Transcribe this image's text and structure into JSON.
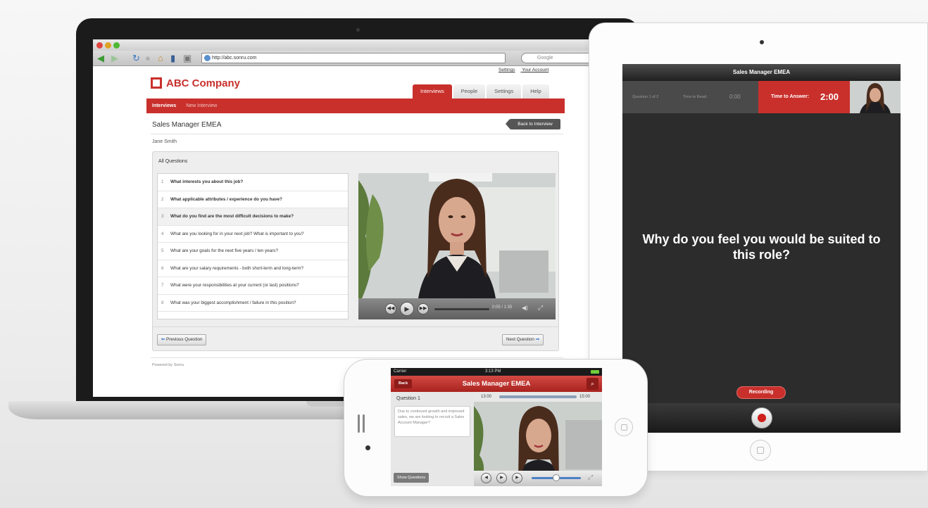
{
  "browser": {
    "url": "http://abc.sonru.com",
    "search_placeholder": "Google"
  },
  "app": {
    "toplinks": [
      "Settings",
      "Your Account"
    ],
    "logo": "ABC Company",
    "tabs": [
      "Interviews",
      "People",
      "Settings",
      "Help"
    ],
    "subnav": [
      "Interviews",
      "New Interview"
    ],
    "job_title": "Sales Manager EMEA",
    "back_label": "Back to Interview",
    "candidate": "Jane Smith",
    "panel_title": "All Questions",
    "questions": [
      "What interests you about this job?",
      "What applicable attributes / experience do you have?",
      "What do you find are the most difficult decisions to make?",
      "What are you looking for in your next job? What is important to you?",
      "What are your goals for the next five years / ten years?",
      "What are your salary requirements - both short-term and long-term?",
      "What were your responsibilities at your current (or last) positions?",
      "What was your biggest accomplishment / failure in this position?"
    ],
    "video_time": "0:05 / 1:35",
    "prev_label": "Previous Question",
    "next_label": "Next Question",
    "powered": "Powered by Sonru"
  },
  "ipad": {
    "title": "Sales Manager EMEA",
    "question_counter": "Question 1 of 2",
    "time_to_read_label": "Time to Read:",
    "time_to_read": "0:00",
    "time_to_answer_label": "Time to Answer:",
    "time_to_answer": "2:00",
    "question": "Why do you feel you would be suited to this role?",
    "recording_label": "Recording"
  },
  "iphone": {
    "carrier": "Carrier",
    "clock": "3:13 PM",
    "back_label": "Back",
    "title": "Sales Manager EMEA",
    "question_label": "Question 1",
    "description": "Due to continued growth and improved sales, we are looking to recruit a Sales Account Manager?",
    "time_start": "13:00",
    "time_end": "15:00",
    "show_questions": "Show Questions"
  },
  "colors": {
    "brand_red": "#c9302c"
  },
  "icons": [
    "back-arrow-icon",
    "forward-arrow-icon",
    "reload-icon",
    "stop-icon",
    "home-icon",
    "bookmark-icon",
    "globe-icon",
    "search-icon",
    "play-icon",
    "rewind-icon",
    "fast-forward-icon",
    "volume-icon",
    "fullscreen-icon",
    "record-icon"
  ]
}
